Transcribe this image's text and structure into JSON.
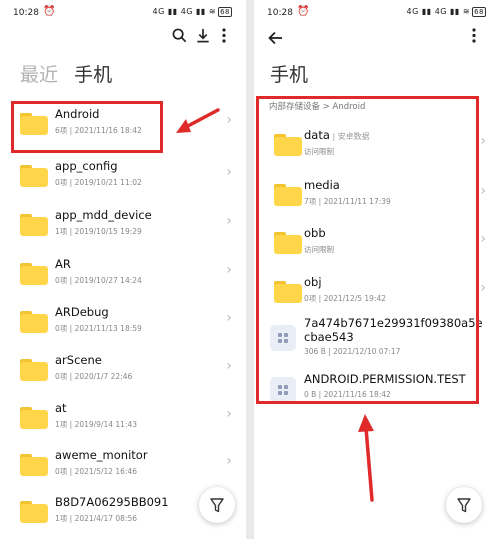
{
  "status_bar": {
    "time": "10:28",
    "alarm": "⏰",
    "signals": "4G ▮▮ 4G ▮▮ ≋",
    "battery": "68"
  },
  "left_screen": {
    "tabs": {
      "recent": "最近",
      "phone": "手机"
    },
    "folders": [
      {
        "name": "Android",
        "meta": "6项 | 2021/11/16 18:42"
      },
      {
        "name": "app_config",
        "meta": "0项 | 2019/10/21 11:02"
      },
      {
        "name": "app_mdd_device",
        "meta": "1项 | 2019/10/15 19:29"
      },
      {
        "name": "AR",
        "meta": "0项 | 2019/10/27 14:24"
      },
      {
        "name": "ARDebug",
        "meta": "0项 | 2021/11/13 18:59"
      },
      {
        "name": "arScene",
        "meta": "0项 | 2020/1/7 22:46"
      },
      {
        "name": "at",
        "meta": "1项 | 2019/9/14 11:43"
      },
      {
        "name": "aweme_monitor",
        "meta": "0项 | 2021/5/12 16:46"
      },
      {
        "name": "B8D7A06295BB091",
        "meta": "1项 | 2021/4/17 08:56"
      }
    ]
  },
  "right_screen": {
    "title": "手机",
    "breadcrumb": "内部存储设备 > Android",
    "items": [
      {
        "name": "data",
        "tag": " | 安卓数据",
        "meta": "访问限制",
        "kind": "folder"
      },
      {
        "name": "media",
        "meta": "7项 | 2021/11/11 17:39",
        "kind": "folder"
      },
      {
        "name": "obb",
        "meta": "访问限制",
        "kind": "folder"
      },
      {
        "name": "obj",
        "meta": "0项 | 2021/12/5 19:42",
        "kind": "folder"
      },
      {
        "name": "7a474b7671e29931f09380a5e",
        "name2": "cbae543",
        "meta": "306 B | 2021/12/10 07:17",
        "kind": "file"
      },
      {
        "name": "ANDROID.PERMISSION.TEST",
        "meta": "0 B | 2021/11/16 18:42",
        "kind": "file"
      }
    ]
  },
  "icons": {
    "search": "search-icon",
    "download": "download-icon",
    "more": "more-icon",
    "back": "back-arrow-icon",
    "filter": "filter-icon",
    "chevron": "chevron-right-icon"
  },
  "colors": {
    "highlight": "#e02a2a",
    "folder": "#ffd54a"
  }
}
